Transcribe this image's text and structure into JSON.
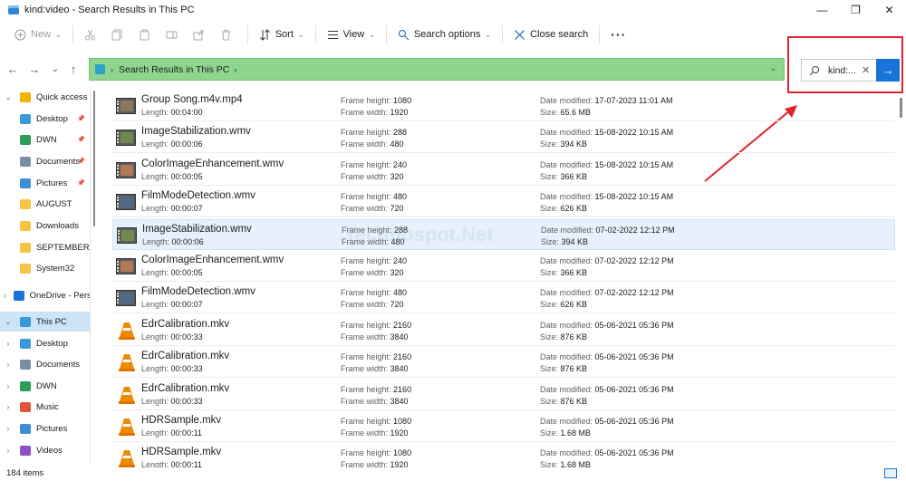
{
  "window": {
    "title": "kind:video - Search Results in This PC",
    "controls": {
      "minimize": "—",
      "maximize": "❐",
      "close": "✕"
    }
  },
  "commandbar": {
    "new_label": "New",
    "sort_label": "Sort",
    "view_label": "View",
    "search_options_label": "Search options",
    "close_search_label": "Close search",
    "more_label": "···"
  },
  "nav": {
    "back": "←",
    "forward": "→",
    "history": "⌄",
    "up": "↑"
  },
  "address": {
    "crumb": "Search Results in This PC"
  },
  "search": {
    "value": "kind:...",
    "clear": "✕",
    "go": "→"
  },
  "sidebar": {
    "items": [
      {
        "label": "Quick access",
        "icon": "star-icon",
        "color": "#f2b400",
        "expand": "⌄"
      },
      {
        "label": "Desktop",
        "icon": "desktop-icon",
        "color": "#3a9ad9",
        "pinned": true
      },
      {
        "label": "DWN",
        "icon": "download-icon",
        "color": "#2a9d57",
        "pinned": true
      },
      {
        "label": "Documents",
        "icon": "documents-icon",
        "color": "#7a8ea6",
        "pinned": true
      },
      {
        "label": "Pictures",
        "icon": "pictures-icon",
        "color": "#3b8fd6",
        "pinned": true
      },
      {
        "label": "AUGUST",
        "icon": "folder-icon",
        "color": "#f4c542"
      },
      {
        "label": "Downloads",
        "icon": "folder-icon",
        "color": "#f4c542"
      },
      {
        "label": "SEPTEMBER",
        "icon": "folder-icon",
        "color": "#f4c542"
      },
      {
        "label": "System32",
        "icon": "folder-icon",
        "color": "#f4c542"
      },
      {
        "label": "OneDrive - Perso",
        "icon": "cloud-icon",
        "color": "#1a73d9",
        "expand": "›"
      },
      {
        "label": "This PC",
        "icon": "pc-icon",
        "color": "#3a9ad9",
        "expand": "⌄"
      },
      {
        "label": "Desktop",
        "icon": "desktop-icon",
        "color": "#3a9ad9",
        "expand": "›"
      },
      {
        "label": "Documents",
        "icon": "documents-icon",
        "color": "#7a8ea6",
        "expand": "›"
      },
      {
        "label": "DWN",
        "icon": "download-icon",
        "color": "#2a9d57",
        "expand": "›"
      },
      {
        "label": "Music",
        "icon": "music-icon",
        "color": "#e0553b",
        "expand": "›"
      },
      {
        "label": "Pictures",
        "icon": "pictures-icon",
        "color": "#3b8fd6",
        "expand": "›"
      },
      {
        "label": "Videos",
        "icon": "videos-icon",
        "color": "#8c4fc7",
        "expand": "›"
      }
    ]
  },
  "labels": {
    "length": "Length:",
    "frame_height": "Frame height:",
    "frame_width": "Frame width:",
    "date_modified": "Date modified:",
    "size": "Size:"
  },
  "files": [
    {
      "name": "Group Song.m4v.mp4",
      "length": "00:04:00",
      "frame_height": "1080",
      "frame_width": "1920",
      "date_modified": "17-07-2023 11:01 AM",
      "size": "65.6 MB",
      "thumb": "video",
      "pic": "#8a7a5a"
    },
    {
      "name": "ImageStabilization.wmv",
      "length": "00:00:06",
      "frame_height": "288",
      "frame_width": "480",
      "date_modified": "15-08-2022 10:15 AM",
      "size": "394 KB",
      "thumb": "video",
      "pic": "#6e8a4e"
    },
    {
      "name": "ColorImageEnhancement.wmv",
      "length": "00:00:05",
      "frame_height": "240",
      "frame_width": "320",
      "date_modified": "15-08-2022 10:15 AM",
      "size": "366 KB",
      "thumb": "video",
      "pic": "#b07a55"
    },
    {
      "name": "FilmModeDetection.wmv",
      "length": "00:00:07",
      "frame_height": "480",
      "frame_width": "720",
      "date_modified": "15-08-2022 10:15 AM",
      "size": "626 KB",
      "thumb": "video",
      "pic": "#4e6a8a"
    },
    {
      "name": "ImageStabilization.wmv",
      "length": "00:00:06",
      "frame_height": "288",
      "frame_width": "480",
      "date_modified": "07-02-2022 12:12 PM",
      "size": "394 KB",
      "thumb": "video",
      "pic": "#6e8a4e",
      "selected": true
    },
    {
      "name": "ColorImageEnhancement.wmv",
      "length": "00:00:05",
      "frame_height": "240",
      "frame_width": "320",
      "date_modified": "07-02-2022 12:12 PM",
      "size": "366 KB",
      "thumb": "video",
      "pic": "#b07a55"
    },
    {
      "name": "FilmModeDetection.wmv",
      "length": "00:00:07",
      "frame_height": "480",
      "frame_width": "720",
      "date_modified": "07-02-2022 12:12 PM",
      "size": "626 KB",
      "thumb": "video",
      "pic": "#4e6a8a"
    },
    {
      "name": "EdrCalibration.mkv",
      "length": "00:00:33",
      "frame_height": "2160",
      "frame_width": "3840",
      "date_modified": "05-06-2021 05:36 PM",
      "size": "876 KB",
      "thumb": "vlc"
    },
    {
      "name": "EdrCalibration.mkv",
      "length": "00:00:33",
      "frame_height": "2160",
      "frame_width": "3840",
      "date_modified": "05-06-2021 05:36 PM",
      "size": "876 KB",
      "thumb": "vlc"
    },
    {
      "name": "EdrCalibration.mkv",
      "length": "00:00:33",
      "frame_height": "2160",
      "frame_width": "3840",
      "date_modified": "05-06-2021 05:36 PM",
      "size": "876 KB",
      "thumb": "vlc"
    },
    {
      "name": "HDRSample.mkv",
      "length": "00:00:11",
      "frame_height": "1080",
      "frame_width": "1920",
      "date_modified": "05-06-2021 05:36 PM",
      "size": "1.68 MB",
      "thumb": "vlc"
    },
    {
      "name": "HDRSample.mkv",
      "length": "00:00:11",
      "frame_height": "1080",
      "frame_width": "1920",
      "date_modified": "05-06-2021 05:36 PM",
      "size": "1.68 MB",
      "thumb": "vlc"
    }
  ],
  "status": {
    "count": "184 items"
  },
  "colors": {
    "address_bg": "#8ed68e",
    "accent": "#1a73d9",
    "highlight": "#e0242c"
  }
}
